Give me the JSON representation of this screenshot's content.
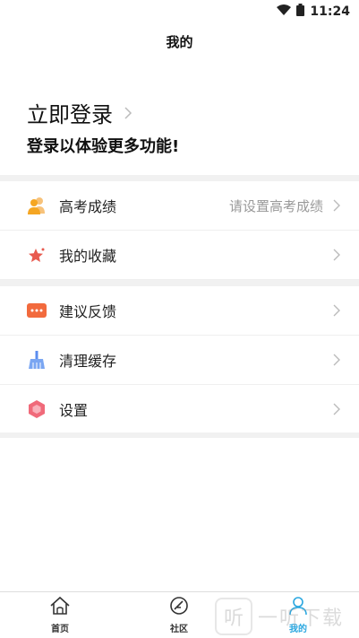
{
  "status_bar": {
    "time": "11:24"
  },
  "header": {
    "title": "我的"
  },
  "login": {
    "title": "立即登录",
    "subtitle": "登录以体验更多功能!"
  },
  "menu": {
    "scores": {
      "label": "高考成绩",
      "value": "请设置高考成绩"
    },
    "favorites": {
      "label": "我的收藏"
    },
    "feedback": {
      "label": "建议反馈"
    },
    "clear_cache": {
      "label": "清理缓存"
    },
    "settings": {
      "label": "设置"
    }
  },
  "tabs": [
    {
      "label": "首页",
      "icon": "home-icon"
    },
    {
      "label": "社区",
      "icon": "community-icon"
    },
    {
      "label": "我的",
      "icon": "profile-icon",
      "active": true
    }
  ],
  "watermark": {
    "text": "一听下载",
    "mark": "听"
  },
  "colors": {
    "accent": "#2aa7e0",
    "orange": "#f5a623",
    "red": "#e85a4f",
    "blue": "#5b8def",
    "pink": "#f06a7a"
  }
}
